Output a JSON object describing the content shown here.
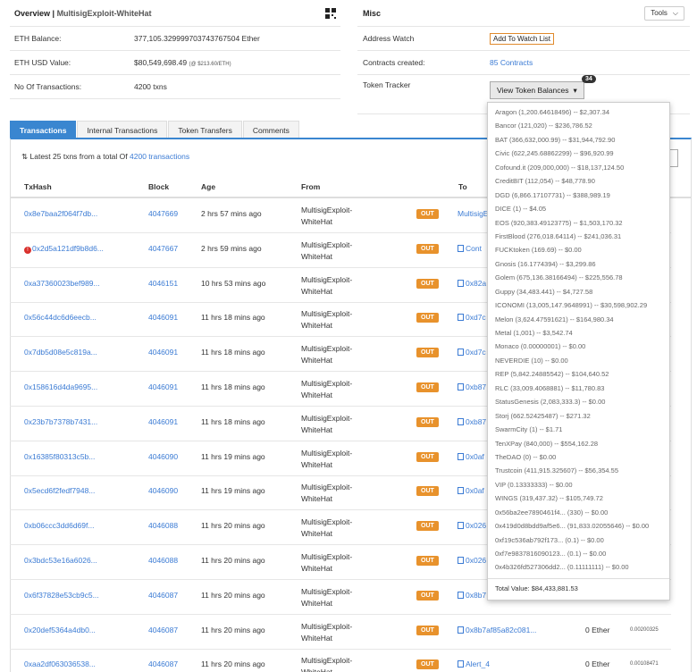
{
  "overview": {
    "title": "Overview",
    "subtitle": "MultisigExploit-WhiteHat",
    "rows": [
      {
        "label": "ETH Balance:",
        "value": "377,105.329999703743767504 Ether",
        "extra": ""
      },
      {
        "label": "ETH USD Value:",
        "value": "$80,549,698.49",
        "extra": "(@ $213.60/ETH)"
      },
      {
        "label": "No Of Transactions:",
        "value": "4200 txns",
        "extra": ""
      }
    ]
  },
  "misc": {
    "title": "Misc",
    "tools_label": "Tools",
    "address_watch_label": "Address Watch",
    "watch_button": "Add To Watch List",
    "contracts_label": "Contracts created:",
    "contracts_value": "85 Contracts",
    "token_tracker_label": "Token Tracker",
    "token_button": "View Token Balances",
    "token_count": "34"
  },
  "tabs": [
    {
      "label": "Transactions",
      "active": true
    },
    {
      "label": "Internal Transactions",
      "active": false
    },
    {
      "label": "Token Transfers",
      "active": false
    },
    {
      "label": "Comments",
      "active": false
    }
  ],
  "latest": {
    "prefix": "Latest 25 txns from a total Of",
    "link": "4200 transactions"
  },
  "table": {
    "headers": [
      "TxHash",
      "Block",
      "Age",
      "From",
      "To"
    ],
    "rows": [
      {
        "hash": "0x8e7baa2f064f7db...",
        "block": "4047669",
        "age": "2 hrs 57 mins ago",
        "from1": "MultisigExploit-",
        "from2": "WhiteHat",
        "dir": "OUT",
        "to": "MultisigE",
        "error": false,
        "contract": false,
        "value": "",
        "fee": ""
      },
      {
        "hash": "0x2d5a121df9b8d6...",
        "block": "4047667",
        "age": "2 hrs 59 mins ago",
        "from1": "MultisigExploit-",
        "from2": "WhiteHat",
        "dir": "OUT",
        "to": "Cont",
        "error": true,
        "contract": true,
        "value": "",
        "fee": ""
      },
      {
        "hash": "0xa37360023bef989...",
        "block": "4046151",
        "age": "10 hrs 53 mins ago",
        "from1": "MultisigExploit-",
        "from2": "WhiteHat",
        "dir": "OUT",
        "to": "0x82a",
        "error": false,
        "contract": true,
        "value": "",
        "fee": ""
      },
      {
        "hash": "0x56c44dc6d6eecb...",
        "block": "4046091",
        "age": "11 hrs 18 mins ago",
        "from1": "MultisigExploit-",
        "from2": "WhiteHat",
        "dir": "OUT",
        "to": "0xd7c",
        "error": false,
        "contract": true,
        "value": "",
        "fee": ""
      },
      {
        "hash": "0x7db5d08e5c819a...",
        "block": "4046091",
        "age": "11 hrs 18 mins ago",
        "from1": "MultisigExploit-",
        "from2": "WhiteHat",
        "dir": "OUT",
        "to": "0xd7c",
        "error": false,
        "contract": true,
        "value": "",
        "fee": ""
      },
      {
        "hash": "0x158616d4da9695...",
        "block": "4046091",
        "age": "11 hrs 18 mins ago",
        "from1": "MultisigExploit-",
        "from2": "WhiteHat",
        "dir": "OUT",
        "to": "0xb87",
        "error": false,
        "contract": true,
        "value": "",
        "fee": ""
      },
      {
        "hash": "0x23b7b7378b7431...",
        "block": "4046091",
        "age": "11 hrs 18 mins ago",
        "from1": "MultisigExploit-",
        "from2": "WhiteHat",
        "dir": "OUT",
        "to": "0xb87",
        "error": false,
        "contract": true,
        "value": "",
        "fee": ""
      },
      {
        "hash": "0x16385f80313c5b...",
        "block": "4046090",
        "age": "11 hrs 19 mins ago",
        "from1": "MultisigExploit-",
        "from2": "WhiteHat",
        "dir": "OUT",
        "to": "0x0af",
        "error": false,
        "contract": true,
        "value": "",
        "fee": ""
      },
      {
        "hash": "0x5ecd6f2fedf7948...",
        "block": "4046090",
        "age": "11 hrs 19 mins ago",
        "from1": "MultisigExploit-",
        "from2": "WhiteHat",
        "dir": "OUT",
        "to": "0x0af",
        "error": false,
        "contract": true,
        "value": "",
        "fee": ""
      },
      {
        "hash": "0xb06ccc3dd6d69f...",
        "block": "4046088",
        "age": "11 hrs 20 mins ago",
        "from1": "MultisigExploit-",
        "from2": "WhiteHat",
        "dir": "OUT",
        "to": "0x026",
        "error": false,
        "contract": true,
        "value": "",
        "fee": ""
      },
      {
        "hash": "0x3bdc53e16a6026...",
        "block": "4046088",
        "age": "11 hrs 20 mins ago",
        "from1": "MultisigExploit-",
        "from2": "WhiteHat",
        "dir": "OUT",
        "to": "0x026",
        "error": false,
        "contract": true,
        "value": "",
        "fee": ""
      },
      {
        "hash": "0x6f37828e53cb9c5...",
        "block": "4046087",
        "age": "11 hrs 20 mins ago",
        "from1": "MultisigExploit-",
        "from2": "WhiteHat",
        "dir": "OUT",
        "to": "0x8b7",
        "error": false,
        "contract": true,
        "value": "",
        "fee": ""
      },
      {
        "hash": "0x20def5364a4db0...",
        "block": "4046087",
        "age": "11 hrs 20 mins ago",
        "from1": "MultisigExploit-",
        "from2": "WhiteHat",
        "dir": "OUT",
        "to": "0x8b7af85a82c081...",
        "error": false,
        "contract": true,
        "value": "0 Ether",
        "fee": "0.00200325"
      },
      {
        "hash": "0xaa2df063036538...",
        "block": "4046087",
        "age": "11 hrs 20 mins ago",
        "from1": "MultisigExploit-",
        "from2": "WhiteHat",
        "dir": "OUT",
        "to": "Alert_4",
        "error": false,
        "contract": true,
        "value": "0 Ether",
        "fee": "0.00108471"
      }
    ]
  },
  "token_dropdown": {
    "items": [
      "Aragon (1,200.64618496) -- $2,307.34",
      "Bancor (121,020) -- $236,786.52",
      "BAT (366,632,000.99) -- $31,944,792.90",
      "Civic (622,245.68862299) -- $96,920.99",
      "Cofound.it (209,000,000) -- $18,137,124.50",
      "CreditBIT (112,054) -- $48,778.90",
      "DGD (6,866.17107731) -- $388,989.19",
      "DICE (1) -- $4.05",
      "EOS (920,383.49123775) -- $1,503,170.32",
      "FirstBlood (276,018.64114) -- $241,036.31",
      "FUCKtoken (169.69) -- $0.00",
      "Gnosis (16.1774394) -- $3,299.86",
      "Golem (675,136.38166494) -- $225,556.78",
      "Guppy (34,483.441) -- $4,727.58",
      "ICONOMI (13,005,147.9648991) -- $30,598,902.29",
      "Melon (3,624.47591621) -- $164,980.34",
      "Metal (1,001) -- $3,542.74",
      "Monaco (0.00000001) -- $0.00",
      "NEVERDIE (10) -- $0.00",
      "REP (5,842.24885542) -- $104,640.52",
      "RLC (33,009.4068881) -- $11,780.83",
      "StatusGenesis (2,083,333.3) -- $0.00",
      "Storj (662.52425487) -- $271.32",
      "SwarmCity (1) -- $1.71",
      "TenXPay (840,000) -- $554,162.28",
      "TheDAO (0) -- $0.00",
      "Trustcoin (411,915.325607) -- $56,354.55",
      "VIP (0.13333333) -- $0.00",
      "WINGS (319,437.32) -- $105,749.72",
      "0x56ba2ee7890461f4... (330) -- $0.00",
      "0x419d0d8bdd9af5e6... (91,833.02055646) -- $0.00",
      "0xf19c536ab792f173... (0.1) -- $0.00",
      "0xf7e983781609012​3... (0.1) -- $0.00",
      "0x4b326fd527306dd2... (0.11111111) -- $0.00"
    ],
    "total": "Total Value: $84,433,881.53"
  }
}
